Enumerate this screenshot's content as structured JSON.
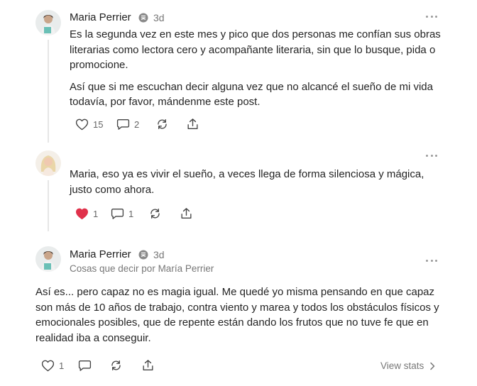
{
  "comments": [
    {
      "author": "Maria Perrier",
      "time": "3d",
      "paragraphs": [
        "Es la segunda vez en este mes y pico que dos personas me confían sus obras literarias como lectora cero y acompañante literaria, sin que lo busque, pida o promocione.",
        "Así que si me escuchan decir alguna vez que no alcancé el sueño de mi vida todavía, por favor, mándenme este post."
      ],
      "likes": "15",
      "replies": "2"
    },
    {
      "author": "",
      "paragraphs": [
        "Maria, eso ya es vivir el sueño, a veces llega de forma silenciosa y mágica, justo como ahora."
      ],
      "likes": "1",
      "replies": "1",
      "liked": true
    },
    {
      "author": "Maria Perrier",
      "time": "3d",
      "subtitle": "Cosas que decir por María Perrier",
      "paragraphs": [
        "Así es... pero capaz no es magia igual. Me quedé yo misma pensando en que capaz son más de 10 años de trabajo, contra viento y marea y todos los obstáculos físicos y emocionales posibles, que de repente están dando los frutos que no tuve fe que en realidad iba a conseguir."
      ],
      "likes": "1",
      "view_stats": "View stats"
    }
  ],
  "icons": {
    "like": "heart-icon",
    "liked": "heart-filled-icon",
    "reply": "comment-bubble-icon",
    "restack": "restack-icon",
    "share": "share-icon",
    "more": "more-dots-icon",
    "badge": "subscriber-badge-icon",
    "chevron": "chevron-right-icon"
  },
  "colors": {
    "liked_heart": "#e0314b",
    "muted_text": "#777777",
    "body_text": "#242424",
    "thread_line": "#e6e6e6"
  }
}
